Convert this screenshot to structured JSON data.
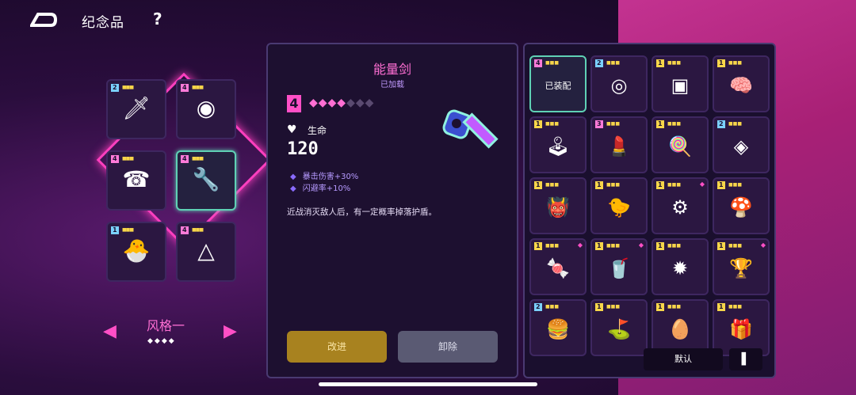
{
  "header": {
    "title": "纪念品",
    "help": "?"
  },
  "slots": [
    {
      "level": "2",
      "glyph": "🗡",
      "color": "#7bd1ff"
    },
    {
      "level": "4",
      "glyph": "◉",
      "color": "#ff7bd9"
    },
    {
      "level": "4",
      "glyph": "☎",
      "color": "#ff7bd9"
    },
    {
      "level": "4",
      "glyph": "🔧",
      "color": "#ff7bd9"
    },
    {
      "level": "1",
      "glyph": "🐣",
      "color": "#7bd1ff"
    },
    {
      "level": "4",
      "glyph": "△",
      "color": "#ff7bd9"
    }
  ],
  "style": {
    "label": "风格一",
    "pager": "◆◆◆◆"
  },
  "detail": {
    "name": "能量剑",
    "state": "已加载",
    "level": "4",
    "pips_on": "◆◆◆◆",
    "pips_off": "◆◆◆",
    "stat_label": "生命",
    "stat_value": "120",
    "bonus1": "暴击伤害+30%",
    "bonus2": "闪避率+10%",
    "description": "近战消灭敌人后，有一定概率掉落护盾。",
    "upgrade": "改进",
    "unequip": "卸除"
  },
  "grid": {
    "equipped_tag": "已装配",
    "default": "默认",
    "sort": "▌",
    "cells": [
      {
        "level": "4",
        "glyph": "",
        "tag": true
      },
      {
        "level": "2",
        "glyph": "◎"
      },
      {
        "level": "1",
        "glyph": "▣"
      },
      {
        "level": "1",
        "glyph": "🧠"
      },
      {
        "level": "1",
        "glyph": "🕹"
      },
      {
        "level": "3",
        "glyph": "💄"
      },
      {
        "level": "1",
        "glyph": "🍭"
      },
      {
        "level": "2",
        "glyph": "◈"
      },
      {
        "level": "1",
        "glyph": "👹"
      },
      {
        "level": "1",
        "glyph": "🐤"
      },
      {
        "level": "1",
        "glyph": "⚙",
        "gem": true
      },
      {
        "level": "1",
        "glyph": "🍄"
      },
      {
        "level": "1",
        "glyph": "🍬",
        "gem": true
      },
      {
        "level": "1",
        "glyph": "🥤",
        "gem": true
      },
      {
        "level": "1",
        "glyph": "✹"
      },
      {
        "level": "1",
        "glyph": "🏆",
        "gem": true
      },
      {
        "level": "2",
        "glyph": "🍔"
      },
      {
        "level": "1",
        "glyph": "⛳"
      },
      {
        "level": "1",
        "glyph": "🥚"
      },
      {
        "level": "1",
        "glyph": "🎁"
      }
    ]
  }
}
